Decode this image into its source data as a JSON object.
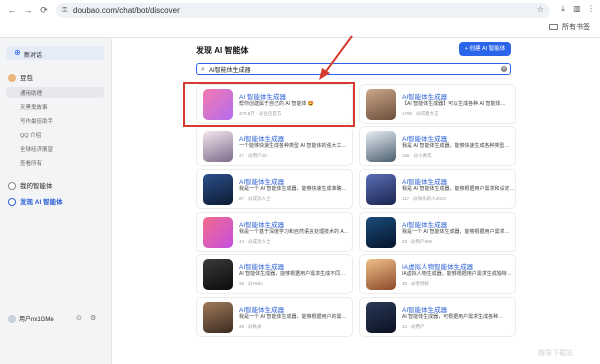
{
  "browser": {
    "url": "doubao.com/chat/bot/discover",
    "bookmarks": "所有书签"
  },
  "sidebar": {
    "new_chat": "新对话",
    "assistant": "豆包",
    "sub_items": [
      "通用助理",
      "天黑鬼故事",
      "写作最佳助手",
      "QQ 介绍",
      "全球经济展望",
      "查看所有"
    ],
    "my_agents": "我的智能体",
    "discover": "发现 AI 智能体",
    "user": "用户nx1GMe"
  },
  "main": {
    "title": "发现 AI 智能体",
    "create_button": "+ 创建 AI 智能体",
    "search_value": "AI智能体生成器"
  },
  "cards": [
    {
      "title": "AI 智能体生成器",
      "desc": "帮你创建属于自己的 AI 智能体 🤩",
      "meta": "470.8万 · @豆包官方"
    },
    {
      "title": "AI智能体生成器",
      "desc": "【AI 智能体生成器】可以生成各种 AI 智能体…",
      "meta": "1780 · @得意大王"
    },
    {
      "title": "AI智能体生成器",
      "desc": "一个能够快速生成各种类型 AI 智能体的强大工…",
      "meta": "27 · @用户20"
    },
    {
      "title": "AI智能体生成器",
      "desc": "我是 AI 智能体生成器，能够快速生成各种类型…",
      "meta": "165 · @小青年"
    },
    {
      "title": "AI智能体生成器",
      "desc": "我是一个 AI 智能体生成器，能够快速生成准确…",
      "meta": "87 · @成功人士"
    },
    {
      "title": "AI智能体生成器",
      "desc": "我是 AI 智能体生成器，能够根据用户需求和设定…",
      "meta": "117 · @快乐的人2023"
    },
    {
      "title": "AI智能体生成器",
      "desc": "我是一个基于深度学习和自然语言处理技术的 A…",
      "meta": "43 · @成功人士"
    },
    {
      "title": "AI智能体生成器",
      "desc": "我是一个 AI 智能体生成器，能够根据用户需求…",
      "meta": "33 · @用户9s9"
    },
    {
      "title": "AI智能体生成器",
      "desc": "AI 智能体生成器，能够根据用户需求生成不同…",
      "meta": "35 · @Hello"
    },
    {
      "title": "IA虚拟人物智能体生成器",
      "desc": "IA虚拟人物生成器，能够根据用户需求生成独特…",
      "meta": "35 · @老师好"
    },
    {
      "title": "AI智能体生成器",
      "desc": "我是一个 AI 智能体生成器，能够根据用户的需…",
      "meta": "28 · @秋米"
    },
    {
      "title": "AI智能体生成器",
      "desc": "AI 智能体生成器，可根据用户需求生成各种…",
      "meta": "12 · @用户"
    }
  ],
  "watermark": "趣导下载站",
  "colors": {
    "accent": "#2b66ea",
    "highlight": "#d63b2f",
    "sidebar_bg": "#f3f4f6"
  }
}
